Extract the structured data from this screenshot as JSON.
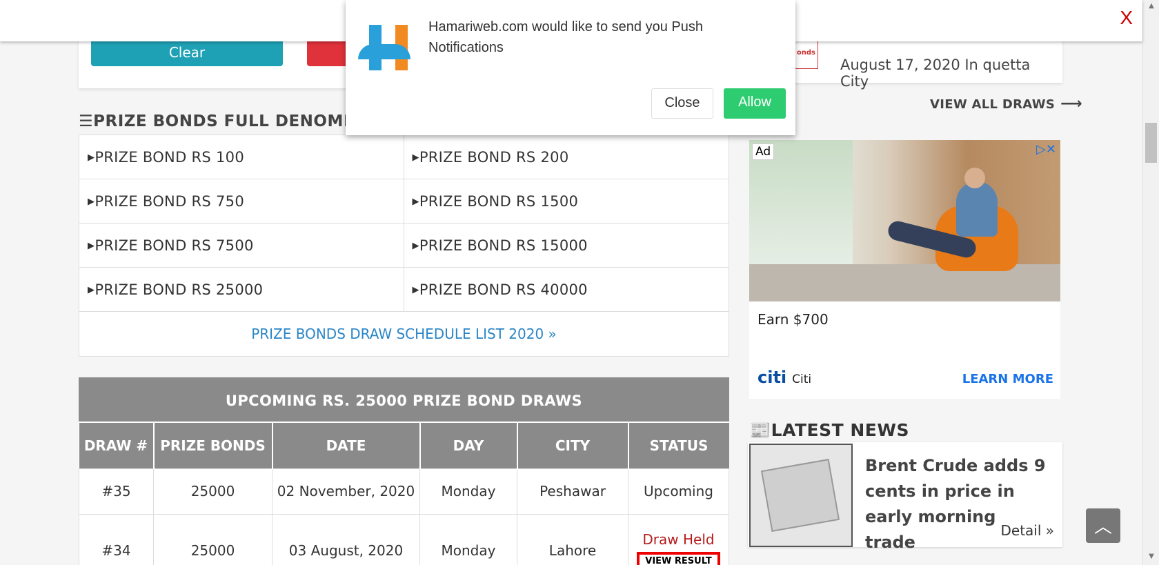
{
  "topbar": {
    "close_label": "X"
  },
  "push_dialog": {
    "message": "Hamariweb.com would like to send you Push Notifications",
    "close_label": "Close",
    "allow_label": "Allow"
  },
  "top_buttons": {
    "clear_label": "Clear"
  },
  "latest_draw": {
    "logo_text": "onds",
    "text": "August 17, 2020 In quetta City"
  },
  "view_all_draws": "VIEW ALL DRAWS",
  "denominations": {
    "title": "PRIZE BONDS FULL DENOMINA",
    "rows": [
      [
        "PRIZE BOND RS 100",
        "PRIZE BOND RS 200"
      ],
      [
        "PRIZE BOND RS 750",
        "PRIZE BOND RS 1500"
      ],
      [
        "PRIZE BOND RS 7500",
        "PRIZE BOND RS 15000"
      ],
      [
        "PRIZE BOND RS 25000",
        "PRIZE BOND RS 40000"
      ]
    ],
    "schedule_link": "PRIZE BONDS DRAW SCHEDULE LIST 2020 »"
  },
  "draws": {
    "title": "UPCOMING RS. 25000 PRIZE BOND DRAWS",
    "columns": [
      "DRAW #",
      "PRIZE BONDS",
      "DATE",
      "DAY",
      "CITY",
      "STATUS"
    ],
    "rows": [
      {
        "draw": "#35",
        "bonds": "25000",
        "date": "02 November, 2020",
        "day": "Monday",
        "city": "Peshawar",
        "status": "Upcoming"
      },
      {
        "draw": "#34",
        "bonds": "25000",
        "date": "03 August, 2020",
        "day": "Monday",
        "city": "Lahore",
        "status": "Draw Held",
        "action": "VIEW RESULT"
      }
    ]
  },
  "ad": {
    "label": "Ad",
    "controls": "▷✕",
    "headline": "Earn $700",
    "brand_logo": "citi",
    "brand": "Citi",
    "cta": "LEARN MORE"
  },
  "news": {
    "title": "LATEST NEWS",
    "headline": "Brent Crude adds 9 cents in price in early morning trade",
    "detail": "Detail »"
  },
  "colors": {
    "accent_blue": "#2a86c6",
    "upcoming_green": "#1a9a1a",
    "held_red": "#b71c1c",
    "header_gray": "#8a8a8a",
    "allow_green": "#2ecc71"
  }
}
